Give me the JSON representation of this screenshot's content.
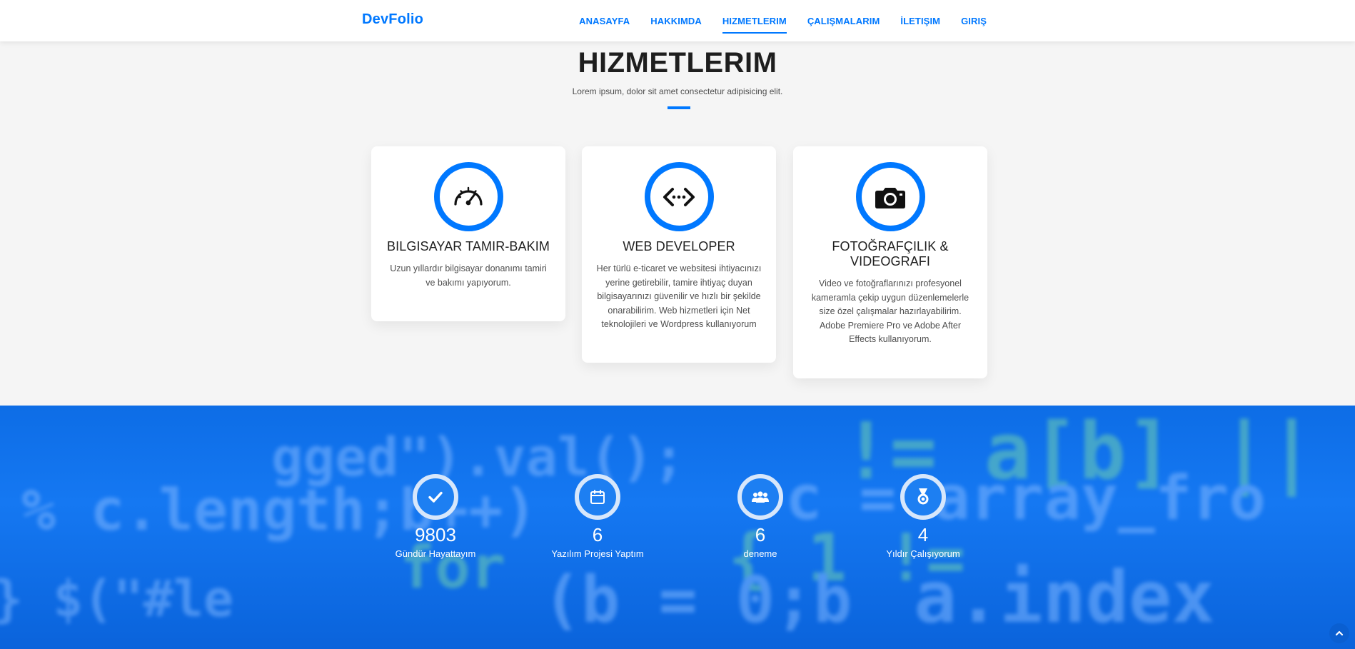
{
  "navbar": {
    "brand": "DevFolio",
    "links": [
      {
        "label": "ANASAYFA",
        "active": false
      },
      {
        "label": "HAKKIMDA",
        "active": false
      },
      {
        "label": "HIZMETLERIM",
        "active": true
      },
      {
        "label": "ÇALIŞMALARIM",
        "active": false
      },
      {
        "label": "İLETIŞIM",
        "active": false
      },
      {
        "label": "GIRIŞ",
        "active": false
      }
    ]
  },
  "services": {
    "title": "HIZMETLERIM",
    "subtitle": "Lorem ipsum, dolor sit amet consectetur adipisicing elit.",
    "cards": [
      {
        "icon": "speedometer-icon",
        "title": "BILGISAYAR TAMIR-BAKIM",
        "text": "Uzun yıllardır bilgisayar donanımı tamiri ve bakımı yapıyorum."
      },
      {
        "icon": "code-icon",
        "title": "WEB DEVELOPER",
        "text": "Her türlü e-ticaret ve websitesi ihtiyacınızı yerine getirebilir, tamire ihtiyaç duyan bilgisayarınızı güvenilir ve hızlı bir şekilde onarabilirim. Web hizmetleri için Net teknolojileri ve Wordpress kullanıyorum"
      },
      {
        "icon": "camera-icon",
        "title": "FOTOĞRAFÇILIK & VIDEOGRAFI",
        "text": "Video ve fotoğraflarınızı profesyonel kameramla çekip uygun düzenlemelerle size özel çalışmalar hazırlayabilirim. Adobe Premiere Pro ve Adobe After Effects kullanıyorum."
      }
    ]
  },
  "counters": [
    {
      "icon": "checkmark-icon",
      "value": "9803",
      "label": "Gündür Hayattayım"
    },
    {
      "icon": "calendar-icon",
      "value": "6",
      "label": "Yazılım Projesi Yaptım"
    },
    {
      "icon": "people-icon",
      "value": "6",
      "label": "deneme"
    },
    {
      "icon": "medal-icon",
      "value": "4",
      "label": "Yıldır Çalışıyorum"
    }
  ],
  "colors": {
    "accent": "#0078ff",
    "heading": "#1e1e1e",
    "body_text": "#4e4e4e",
    "page_bg": "#f5f5f5"
  },
  "back_to_top": {
    "icon": "chevron-up-icon"
  }
}
